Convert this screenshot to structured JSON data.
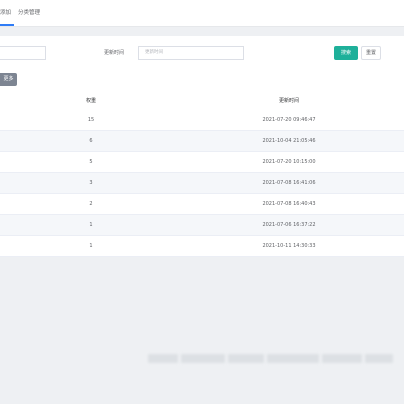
{
  "tabs": [
    {
      "label": "添加"
    },
    {
      "label": "分类管理"
    }
  ],
  "filters": {
    "update_time_label": "更新时间",
    "date_placeholder": "更新时间",
    "search_button": "搜索",
    "reset_button": "重置",
    "more_button": "更多"
  },
  "table": {
    "columns": [
      "权重",
      "更新时间"
    ],
    "rows": [
      {
        "weight": "15",
        "updated": "2021-07-20 09:46:47"
      },
      {
        "weight": "6",
        "updated": "2021-10-04 21:05:46"
      },
      {
        "weight": "5",
        "updated": "2021-07-20 10:15:00"
      },
      {
        "weight": "3",
        "updated": "2021-07-08 16:41:06"
      },
      {
        "weight": "2",
        "updated": "2021-07-08 16:40:43"
      },
      {
        "weight": "1",
        "updated": "2021-07-06 16:37:22"
      },
      {
        "weight": "1",
        "updated": "2021-10-11 14:30:33"
      }
    ]
  },
  "colors": {
    "accent": "#1eb09a",
    "tab_indicator": "#2f7cf6",
    "more_button": "#7d8592",
    "stripe": "#f5f7fa",
    "background": "#eef0f3"
  }
}
